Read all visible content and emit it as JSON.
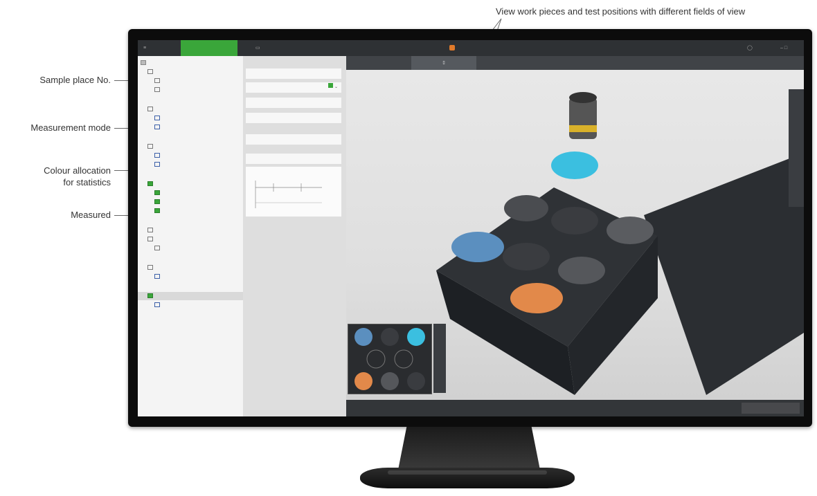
{
  "callouts": {
    "top": "View work pieces and test positions with different fields of view",
    "sample_place": "Sample place No.",
    "measurement_mode": "Measurement mode",
    "colour_allocation_1": "Colour allocation",
    "colour_allocation_2": "for statistics",
    "measured": "Measured"
  },
  "colors": {
    "accent": "#3aa63a",
    "orange": "#e07a2a",
    "cyan": "#3bbfe0"
  }
}
